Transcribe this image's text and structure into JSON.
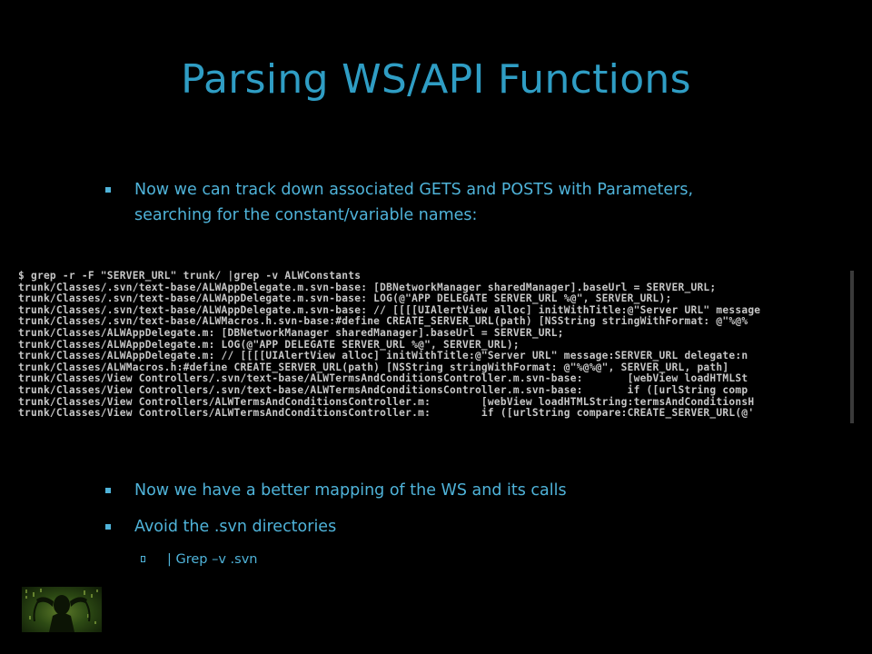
{
  "slide": {
    "title": "Parsing WS/API Functions",
    "bullets": [
      {
        "line1": "Now we can track down associated GETS and POSTS with Parameters,",
        "line2": "searching for the constant/variable names:"
      },
      {
        "text": "Now we have a better mapping of the WS and its calls"
      },
      {
        "text": "Avoid the .svn directories"
      }
    ],
    "sub_bullets": [
      {
        "text": "| Grep –v .svn"
      }
    ]
  },
  "terminal": {
    "lines": [
      "$ grep -r -F \"SERVER_URL\" trunk/ |grep -v ALWConstants",
      "trunk/Classes/.svn/text-base/ALWAppDelegate.m.svn-base: [DBNetworkManager sharedManager].baseUrl = SERVER_URL;",
      "trunk/Classes/.svn/text-base/ALWAppDelegate.m.svn-base: LOG(@\"APP DELEGATE SERVER_URL %@\", SERVER_URL);",
      "trunk/Classes/.svn/text-base/ALWAppDelegate.m.svn-base: // [[[[UIAlertView alloc] initWithTitle:@\"Server URL\" message",
      "trunk/Classes/.svn/text-base/ALWMacros.h.svn-base:#define CREATE_SERVER_URL(path) [NSString stringWithFormat: @\"%@%",
      "trunk/Classes/ALWAppDelegate.m: [DBNetworkManager sharedManager].baseUrl = SERVER_URL;",
      "trunk/Classes/ALWAppDelegate.m: LOG(@\"APP DELEGATE SERVER_URL %@\", SERVER_URL);",
      "trunk/Classes/ALWAppDelegate.m: // [[[[UIAlertView alloc] initWithTitle:@\"Server URL\" message:SERVER_URL delegate:n",
      "trunk/Classes/ALWMacros.h:#define CREATE_SERVER_URL(path) [NSString stringWithFormat: @\"%@%@\", SERVER_URL, path]",
      "trunk/Classes/View Controllers/.svn/text-base/ALWTermsAndConditionsController.m.svn-base:       [webView loadHTMLSt",
      "trunk/Classes/View Controllers/.svn/text-base/ALWTermsAndConditionsController.m.svn-base:       if ([urlString comp",
      "trunk/Classes/View Controllers/ALWTermsAndConditionsController.m:        [webView loadHTMLString:termsAndConditionsH",
      "trunk/Classes/View Controllers/ALWTermsAndConditionsController.m:        if ([urlString compare:CREATE_SERVER_URL(@'"
    ]
  },
  "colors": {
    "background": "#000000",
    "title": "#2F9DC4",
    "bullet_text": "#4FB3D9",
    "terminal_text": "#C7C7C7"
  },
  "icons": {
    "bullet_marker": "filled-square-bullet",
    "sub_bullet_marker": "hollow-square-bullet",
    "logo": "matrix-figure-logo"
  }
}
